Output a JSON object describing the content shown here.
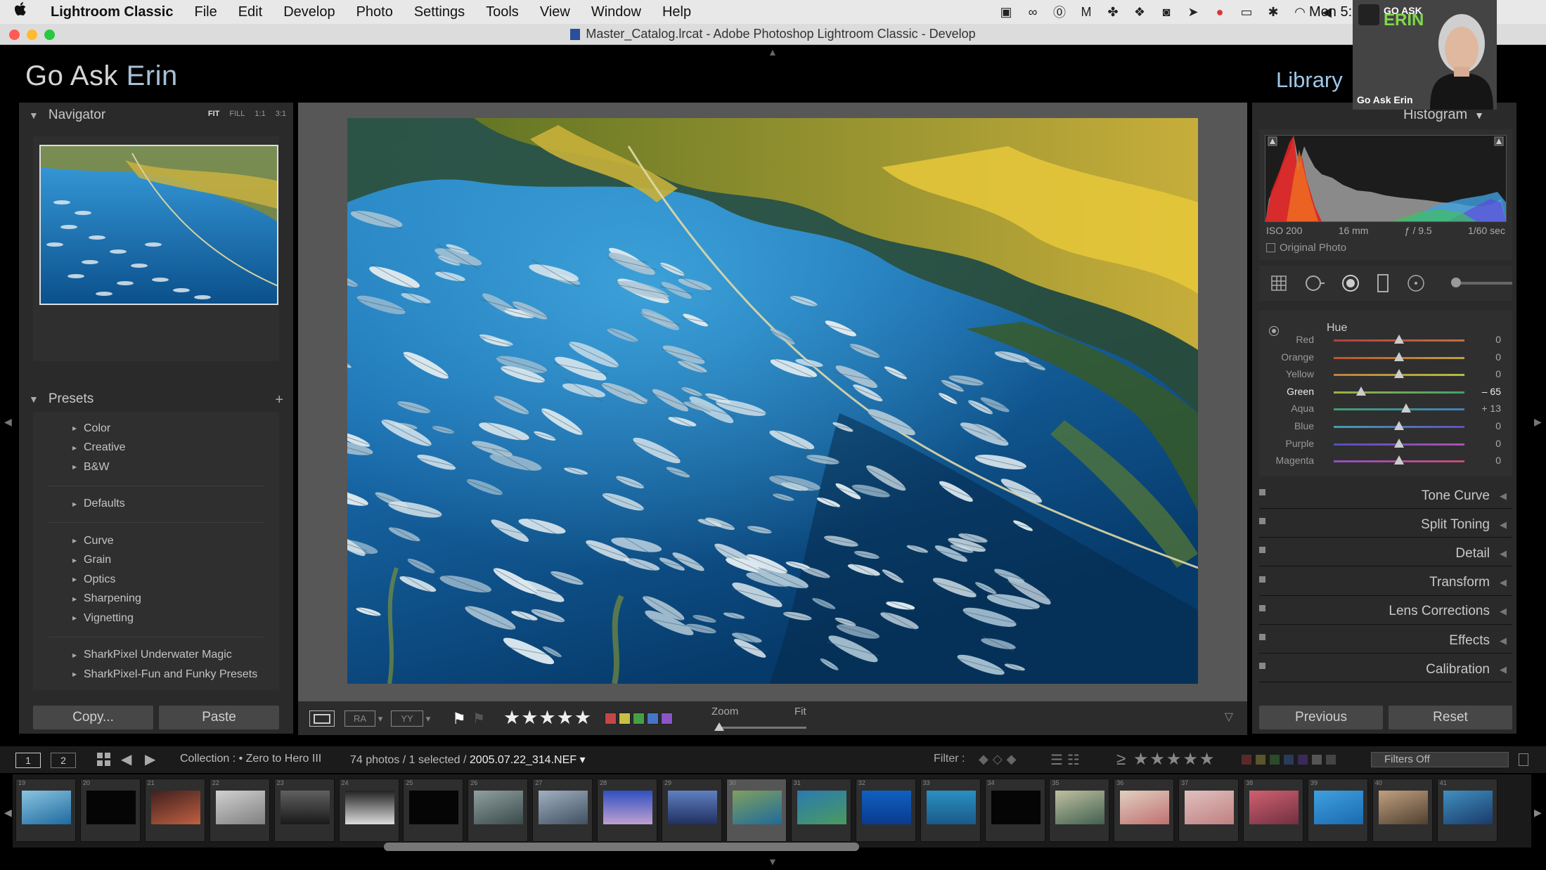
{
  "menubar": {
    "apple": "",
    "app_name": "Lightroom Classic",
    "items": [
      "File",
      "Edit",
      "Develop",
      "Photo",
      "Settings",
      "Tools",
      "View",
      "Window",
      "Help"
    ],
    "clock": "Mon 5:"
  },
  "window": {
    "title": "Master_Catalog.lrcat - Adobe Photoshop Lightroom Classic - Develop"
  },
  "identity_plate": {
    "first": "Go Ask ",
    "highlight": "Erin"
  },
  "module_picker": {
    "current": "Library"
  },
  "navigator": {
    "title": "Navigator",
    "zoom_options": [
      "FIT",
      "FILL",
      "1:1",
      "3:1"
    ]
  },
  "presets": {
    "title": "Presets",
    "add": "+",
    "groups": [
      [
        "Color",
        "Creative",
        "B&W"
      ],
      [
        "Defaults"
      ],
      [
        "Curve",
        "Grain",
        "Optics",
        "Sharpening",
        "Vignetting"
      ],
      [
        "SharkPixel Underwater Magic",
        "SharkPixel-Fun and Funky Presets"
      ]
    ]
  },
  "left_buttons": {
    "copy": "Copy...",
    "paste": "Paste"
  },
  "right_panel": {
    "histogram_title": "Histogram",
    "exif": {
      "iso": "ISO 200",
      "focal": "16 mm",
      "aperture": "ƒ / 9.5",
      "shutter": "1/60 sec"
    },
    "original_photo": "Original Photo",
    "hsl": {
      "title": "Hue",
      "rows": [
        {
          "name": "Red",
          "value": "0",
          "pos": 0.5,
          "active": false,
          "grad": "linear-gradient(90deg,#b04040,#c07040)"
        },
        {
          "name": "Orange",
          "value": "0",
          "pos": 0.5,
          "active": false,
          "grad": "linear-gradient(90deg,#c05030,#c0a040)"
        },
        {
          "name": "Yellow",
          "value": "0",
          "pos": 0.5,
          "active": false,
          "grad": "linear-gradient(90deg,#c08040,#b0c040)"
        },
        {
          "name": "Green",
          "value": "– 65",
          "pos": 0.207,
          "active": true,
          "grad": "linear-gradient(90deg,#a0b040,#40a070)"
        },
        {
          "name": "Aqua",
          "value": "+ 13",
          "pos": 0.555,
          "active": false,
          "grad": "linear-gradient(90deg,#40a070,#4080c0)"
        },
        {
          "name": "Blue",
          "value": "0",
          "pos": 0.5,
          "active": false,
          "grad": "linear-gradient(90deg,#40a0b0,#6050c0)"
        },
        {
          "name": "Purple",
          "value": "0",
          "pos": 0.5,
          "active": false,
          "grad": "linear-gradient(90deg,#5050c0,#b050b0)"
        },
        {
          "name": "Magenta",
          "value": "0",
          "pos": 0.5,
          "active": false,
          "grad": "linear-gradient(90deg,#9050c0,#c05070)"
        }
      ]
    },
    "panels": [
      "Tone Curve",
      "Split Toning",
      "Detail",
      "Transform",
      "Lens Corrections",
      "Effects",
      "Calibration"
    ],
    "previous": "Previous",
    "reset": "Reset"
  },
  "toolbar": {
    "stars": "★★★★★",
    "zoom_label": "Zoom",
    "fit_label": "Fit",
    "color_labels": [
      "#c84545",
      "#c8c045",
      "#45a045",
      "#4575c8",
      "#8a55c8"
    ]
  },
  "filmstrip_bar": {
    "view1": "1",
    "view2": "2",
    "collection": "Collection : • Zero to Hero III",
    "count_prefix": "74 photos / 1 selected / ",
    "filename": "2005.07.22_314.NEF ▾",
    "filter_label": "Filter :",
    "filter_stars": "≥ ★★★★★",
    "filters_off": "Filters Off"
  },
  "filmstrip": {
    "numbers": [
      "19",
      "20",
      "21",
      "22",
      "23",
      "24",
      "25",
      "26",
      "27",
      "28",
      "29",
      "30",
      "31",
      "32",
      "33",
      "34",
      "35",
      "36",
      "37",
      "38",
      "39",
      "40",
      "41"
    ],
    "selected_index": 11,
    "thumb_colors": [
      "linear-gradient(160deg,#8ac4e0,#1e6aa0)",
      "#050505",
      "linear-gradient(160deg,#402020,#c06040)",
      "linear-gradient(160deg,#d0d0d0,#808080)",
      "linear-gradient(180deg,#606060,#1a1a1a)",
      "linear-gradient(180deg,#222,#ddd)",
      "#050505",
      "linear-gradient(160deg,#90a0a0,#3a4a4a)",
      "linear-gradient(160deg,#a0b0c0,#405060)",
      "linear-gradient(180deg,#3050c0,#c0a0d0)",
      "linear-gradient(180deg,#6080c0,#203060)",
      "linear-gradient(160deg,#80a060,#1e6a9a)",
      "linear-gradient(160deg,#2a7ab0,#4a9a60)",
      "linear-gradient(180deg,#1060c0,#0a3a90)",
      "linear-gradient(180deg,#2a90c0,#1a5a8a)",
      "#050505",
      "linear-gradient(160deg,#c0c0a0,#406050)",
      "linear-gradient(160deg,#e0d0c0,#c07070)",
      "linear-gradient(160deg,#e0c0c0,#c08080)",
      "linear-gradient(160deg,#d06070,#703040)",
      "linear-gradient(160deg,#40a0e0,#1a6ab0)",
      "linear-gradient(160deg,#c0a080,#504030)",
      "linear-gradient(160deg,#4090c0,#1a3a6a)"
    ]
  },
  "webcam": {
    "logo_small": "GO ASK",
    "logo_big": "ERIN",
    "label": "Go Ask Erin"
  }
}
